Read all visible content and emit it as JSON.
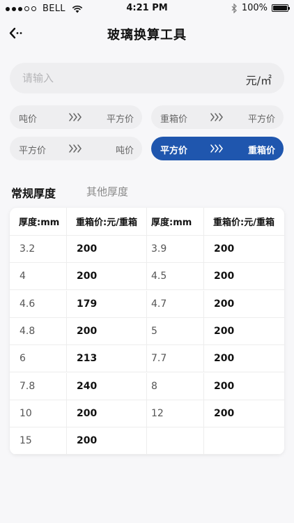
{
  "status_bar": {
    "carrier": "BELL",
    "time": "4:21 PM",
    "battery": "100%",
    "battery_level": 1.0,
    "icons": [
      "signal-dots",
      "wifi-icon",
      "bluetooth-icon",
      "battery-icon"
    ]
  },
  "nav": {
    "back_icon": "back-icon",
    "title": "玻璃换算工具"
  },
  "input": {
    "placeholder": "请输入",
    "value": "",
    "unit": "元/㎡"
  },
  "modes": [
    {
      "from": "吨价",
      "to": "平方价",
      "active": false
    },
    {
      "from": "重箱价",
      "to": "平方价",
      "active": false
    },
    {
      "from": "平方价",
      "to": "吨价",
      "active": false
    },
    {
      "from": "平方价",
      "to": "重箱价",
      "active": true
    }
  ],
  "mode_arrow_icon": "triple-chevron-right-icon",
  "accent_color": "#1f56ae",
  "tabs": [
    {
      "label": "常规厚度",
      "active": true
    },
    {
      "label": "其他厚度",
      "active": false
    }
  ],
  "table": {
    "headers": [
      "厚度:mm",
      "重箱价:元/重箱",
      "厚度:mm",
      "重箱价:元/重箱"
    ],
    "rows": [
      [
        "3.2",
        "200",
        "3.9",
        "200"
      ],
      [
        "4",
        "200",
        "4.5",
        "200"
      ],
      [
        "4.6",
        "179",
        "4.7",
        "200"
      ],
      [
        "4.8",
        "200",
        "5",
        "200"
      ],
      [
        "6",
        "213",
        "7.7",
        "200"
      ],
      [
        "7.8",
        "240",
        "8",
        "200"
      ],
      [
        "10",
        "200",
        "12",
        "200"
      ],
      [
        "15",
        "200",
        "",
        ""
      ]
    ]
  }
}
